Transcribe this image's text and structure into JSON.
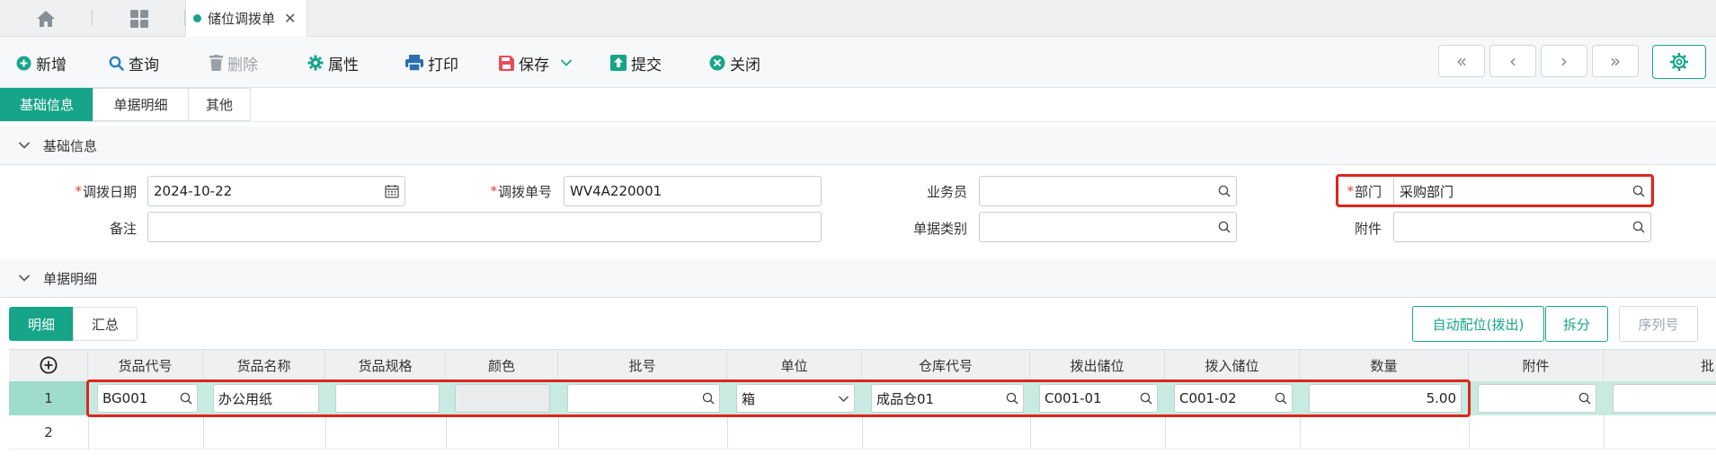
{
  "tabs": {
    "active_label": "储位调拨单",
    "accent": "#17a589"
  },
  "toolbar": {
    "new_label": "新增",
    "query_label": "查询",
    "delete_label": "删除",
    "properties_label": "属性",
    "print_label": "打印",
    "save_label": "保存",
    "submit_label": "提交",
    "close_label": "关闭"
  },
  "section_tabs": [
    "基础信息",
    "单据明细",
    "其他"
  ],
  "basic_section": {
    "title": "基础信息",
    "fields": {
      "transfer_date": {
        "label": "调拨日期",
        "value": "2024-10-22",
        "required": "*"
      },
      "transfer_no": {
        "label": "调拨单号",
        "value": "WV4A220001",
        "required": "*"
      },
      "salesperson": {
        "label": "业务员",
        "value": ""
      },
      "department": {
        "label": "部门",
        "value": "采购部门",
        "required": "*"
      },
      "remark": {
        "label": "备注",
        "value": ""
      },
      "doc_category": {
        "label": "单据类别",
        "value": ""
      },
      "attachment": {
        "label": "附件",
        "value": ""
      }
    }
  },
  "detail_section": {
    "title": "单据明细",
    "sub_tabs": [
      "明细",
      "汇总"
    ],
    "auto_allocate_label": "自动配位(拨出)",
    "split_label": "拆分",
    "serial_label": "序列号",
    "columns": [
      "货品代号",
      "货品名称",
      "货品规格",
      "颜色",
      "批号",
      "单位",
      "仓库代号",
      "拨出储位",
      "拨入储位",
      "数量",
      "附件",
      "批"
    ],
    "rows": [
      {
        "num": "1",
        "item_code": "BG001",
        "item_name": "办公用纸",
        "spec": "",
        "color": "",
        "batch": "",
        "unit": "箱",
        "warehouse": "成品仓01",
        "from_bin": "C001-01",
        "to_bin": "C001-02",
        "qty": "5.00",
        "attachment": ""
      },
      {
        "num": "2"
      }
    ]
  }
}
